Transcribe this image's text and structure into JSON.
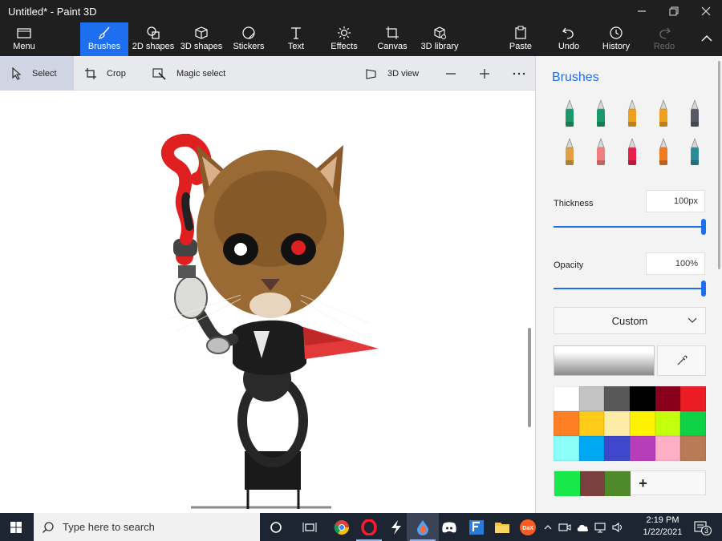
{
  "window": {
    "title": "Untitled* - Paint 3D"
  },
  "ribbon": {
    "menu": "Menu",
    "brushes": "Brushes",
    "shapes2d": "2D shapes",
    "shapes3d": "3D shapes",
    "stickers": "Stickers",
    "text": "Text",
    "effects": "Effects",
    "canvas": "Canvas",
    "library3d": "3D library",
    "paste": "Paste",
    "undo": "Undo",
    "history": "History",
    "redo": "Redo"
  },
  "toolbar": {
    "select": "Select",
    "crop": "Crop",
    "magic_select": "Magic select",
    "view3d": "3D view"
  },
  "panel": {
    "title": "Brushes",
    "brushes": [
      {
        "icon": "marker-brush-icon",
        "color": "#1a9a6a"
      },
      {
        "icon": "calligraphy-pen-icon",
        "color": "#1a9a6a"
      },
      {
        "icon": "oil-brush-icon",
        "color": "#f0a020"
      },
      {
        "icon": "watercolor-brush-icon",
        "color": "#f0a020"
      },
      {
        "icon": "pixel-pen-icon",
        "color": "#555a66"
      },
      {
        "icon": "pencil-icon",
        "color": "#e0a040"
      },
      {
        "icon": "eraser-icon",
        "color": "#f08080"
      },
      {
        "icon": "crayon-icon",
        "color": "#e8204a"
      },
      {
        "icon": "spray-can-icon",
        "color": "#f07a20"
      },
      {
        "icon": "fill-bucket-icon",
        "color": "#2a8a9a"
      }
    ],
    "thickness_label": "Thickness",
    "thickness_value": "100px",
    "thickness_level": 1.0,
    "opacity_label": "Opacity",
    "opacity_value": "100%",
    "opacity_level": 1.0,
    "texture": "Custom",
    "palette": [
      "#ffffff",
      "#c3c3c3",
      "#585858",
      "#000000",
      "#88001b",
      "#ec1c24",
      "#ff7f27",
      "#ffca18",
      "#fdeca6",
      "#fff200",
      "#c4ff0e",
      "#0ed145",
      "#8cfffb",
      "#00a8f3",
      "#3f48cc",
      "#b83dba",
      "#ffaec8",
      "#b97a56"
    ],
    "custom_colors": [
      "#19e84a",
      "#7a4040",
      "#4f8a2a"
    ]
  },
  "taskbar": {
    "search_placeholder": "Type here to search",
    "time": "2:19 PM",
    "date": "1/22/2021",
    "notifications": "3"
  },
  "colors": {
    "accent": "#1e6ef0",
    "taskbar": "#1d2533",
    "ribbon": "#1f1f1f"
  }
}
